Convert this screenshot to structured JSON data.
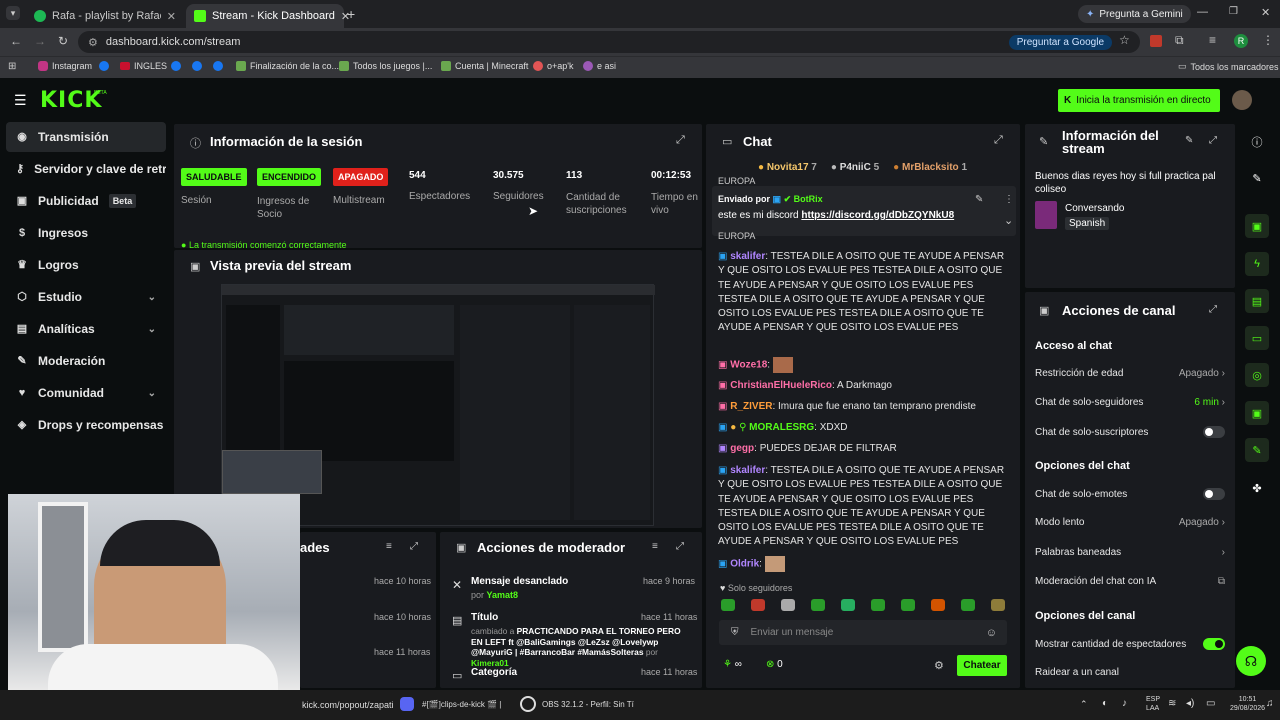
{
  "browser": {
    "tabs": [
      {
        "label": "Rafa - playlist by Rafael.xared |"
      },
      {
        "label": "Stream - Kick Dashboard"
      }
    ],
    "gemini": "Pregunta a Gemini",
    "url": "dashboard.kick.com/stream",
    "google_btn": "Preguntar a Google",
    "profile_initial": "R",
    "bookmarks": [
      "Instagram",
      "INGLES",
      "Finalización de la co...",
      "Todos los juegos |...",
      "Cuenta | Minecraft",
      "o+ap'k",
      "e asi"
    ],
    "all_bookmarks": "Todos los marcadores"
  },
  "header": {
    "logo": "KICK",
    "logo_beta": "BETA",
    "go_live": "Inicia la transmisión en directo"
  },
  "sidebar": {
    "items": [
      {
        "label": "Transmisión",
        "icon": "broadcast-icon"
      },
      {
        "label": "Servidor y clave de retransmisión",
        "icon": "key-icon"
      },
      {
        "label": "Publicidad",
        "icon": "megaphone-icon",
        "tag": "Beta"
      },
      {
        "label": "Ingresos",
        "icon": "dollar-icon"
      },
      {
        "label": "Logros",
        "icon": "trophy-icon"
      },
      {
        "label": "Estudio",
        "icon": "studio-icon"
      },
      {
        "label": "Analíticas",
        "icon": "chart-icon"
      },
      {
        "label": "Moderación",
        "icon": "wrench-icon"
      },
      {
        "label": "Comunidad",
        "icon": "community-icon"
      },
      {
        "label": "Drops y recompensas",
        "icon": "gift-icon"
      }
    ]
  },
  "session": {
    "title": "Información de la sesión",
    "stats": [
      {
        "value": "SALUDABLE",
        "label": "Sesión"
      },
      {
        "value": "ENCENDIDO",
        "label": "Ingresos de Socio"
      },
      {
        "value": "APAGADO",
        "label": "Multistream"
      },
      {
        "value": "544",
        "label": "Espectadores"
      },
      {
        "value": "30.575",
        "label": "Seguidores"
      },
      {
        "value": "113",
        "label": "Cantidad de suscripciones"
      },
      {
        "value": "00:12:53",
        "label": "Tiempo en vivo"
      }
    ],
    "status_line": "La transmisión comenzó correctamente"
  },
  "preview": {
    "title": "Vista previa del stream"
  },
  "activity": {
    "title_fragment": "ades",
    "times": [
      "hace 10 horas",
      "hace 10 horas",
      "hace 11 horas"
    ]
  },
  "mod_actions": {
    "title": "Acciones de moderador",
    "items": [
      {
        "title": "Mensaje desanclado",
        "by_prefix": "por",
        "by": "Yamat8",
        "time": "hace 9 horas"
      },
      {
        "title": "Título",
        "time": "hace 11 horas",
        "detail_prefix": "cambiado a",
        "detail": "PRACTICANDO PARA EL TORNEO PERO EN LEFT ft @BaliGamings @LeZsz @Lovelywp @MayuriG | #BarrancoBar #MamásSolteras",
        "by_prefix": "por",
        "by": "Kimera01"
      },
      {
        "title": "Categoría",
        "time": "hace 11 horas"
      }
    ]
  },
  "chat": {
    "title": "Chat",
    "top_gifters": [
      {
        "name": "Novita17",
        "count": "7"
      },
      {
        "name": "P4niiC",
        "count": "5"
      },
      {
        "name": "MrBlacksito",
        "count": "1"
      }
    ],
    "pinned": {
      "sent_by_prefix": "Enviado por",
      "sender": "BotRix",
      "text": "este es mi discord",
      "link": "https://discord.gg/dDbZQYNkU8"
    },
    "europa": "EUROPA",
    "messages": [
      {
        "user": "skalifer",
        "color": "#b186ff",
        "text": "TESTEA DILE A OSITO QUE TE AYUDE A PENSAR Y QUE OSITO LOS EVALUE PES TESTEA DILE A OSITO QUE TE AYUDE A PENSAR Y QUE OSITO LOS EVALUE PES TESTEA DILE A OSITO QUE TE AYUDE A PENSAR Y QUE OSITO LOS EVALUE PES TESTEA DILE A OSITO QUE TE AYUDE A PENSAR Y QUE OSITO LOS EVALUE PES"
      },
      {
        "user": "Woze18",
        "color": "#ff6fa8",
        "text": ""
      },
      {
        "user": "ChristianElHueleRico",
        "color": "#ff6fa8",
        "text": "A Darkmago"
      },
      {
        "user": "R_ZIVER",
        "color": "#ff9d3a",
        "text": "Imura que fue enano tan temprano prendiste"
      },
      {
        "user": "MORALESRG",
        "color": "#53fc18",
        "text": "XDXD"
      },
      {
        "user": "gegp",
        "color": "#ff6fa8",
        "text": "PUEDES DEJAR DE FILTRAR"
      },
      {
        "user": "skalifer",
        "color": "#b186ff",
        "text": "TESTEA DILE A OSITO QUE TE AYUDE A PENSAR Y QUE OSITO LOS EVALUE PES TESTEA DILE A OSITO QUE TE AYUDE A PENSAR Y QUE OSITO LOS EVALUE PES TESTEA DILE A OSITO QUE TE AYUDE A PENSAR Y QUE OSITO LOS EVALUE PES TESTEA DILE A OSITO QUE TE AYUDE A PENSAR Y QUE OSITO LOS EVALUE PES"
      },
      {
        "user": "Oldrik",
        "color": "#b186ff",
        "text": ""
      }
    ],
    "followers_only": "Solo seguidores",
    "input_placeholder": "Enviar un mensaje",
    "points": "0",
    "send": "Chatear"
  },
  "stream_info": {
    "title": "Información del stream",
    "stream_title": "Buenos dias reyes hoy si full practica pal coliseo",
    "category": "Conversando",
    "language": "Spanish"
  },
  "channel_actions": {
    "title": "Acciones de canal",
    "sections": [
      {
        "title": "Acceso al chat",
        "rows": [
          {
            "label": "Restricción de edad",
            "value": "Apagado"
          },
          {
            "label": "Chat de solo-seguidores",
            "value": "6 min"
          },
          {
            "label": "Chat de solo-suscriptores",
            "value": ""
          }
        ]
      },
      {
        "title": "Opciones del chat",
        "rows": [
          {
            "label": "Chat de solo-emotes",
            "value": ""
          },
          {
            "label": "Modo lento",
            "value": "Apagado"
          },
          {
            "label": "Palabras baneadas",
            "value": ""
          },
          {
            "label": "Moderación del chat con IA",
            "value": ""
          }
        ]
      },
      {
        "title": "Opciones del canal",
        "rows": [
          {
            "label": "Mostrar cantidad de espectadores",
            "value": ""
          },
          {
            "label": "Raidear a un canal",
            "value": ""
          }
        ]
      }
    ]
  },
  "taskbar": {
    "popout": "kick.com/popout/zapati",
    "discord": "#[🎬]clips-de-kick 🎬 |",
    "obs": "OBS 32.1.2 - Perfil: Sin Tí",
    "lang": "ESP",
    "lang2": "LAA",
    "time": "10:51",
    "date": "29/08/2026"
  },
  "colors": {
    "accent": "#53fc18",
    "panel": "#191b1f",
    "bg": "#0b0e0f"
  }
}
